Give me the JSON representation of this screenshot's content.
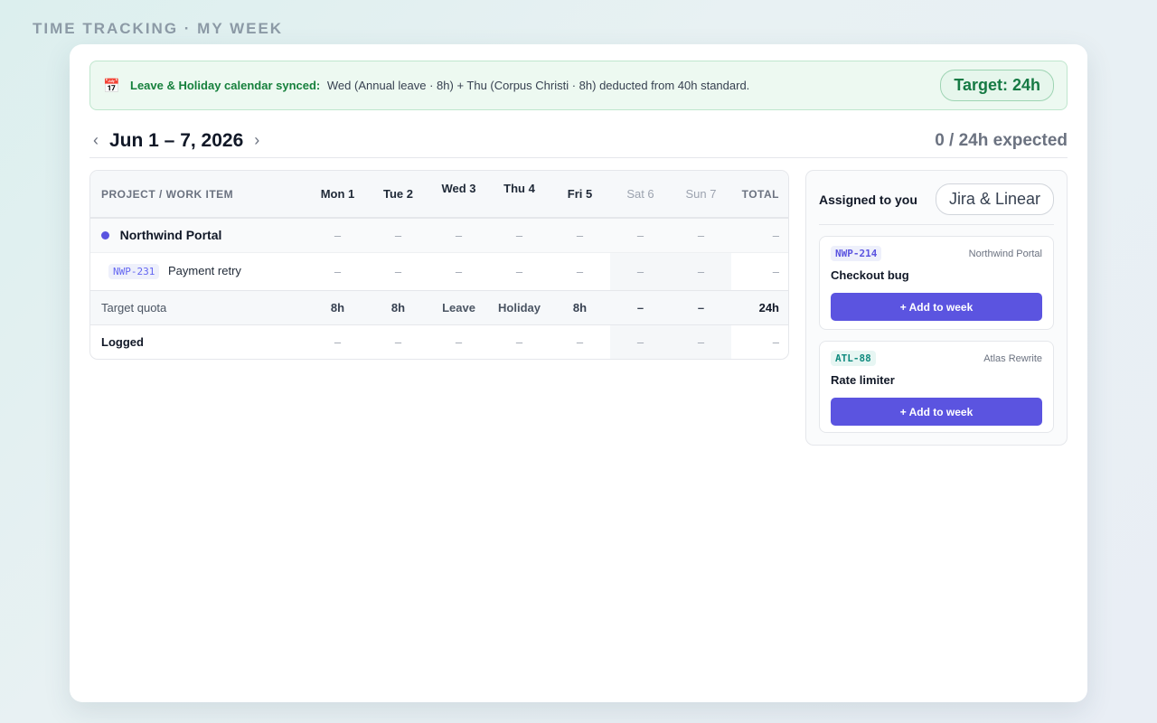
{
  "page_title": "TIME TRACKING · MY WEEK",
  "banner": {
    "icon": "calendar-icon",
    "label": "Leave & Holiday calendar synced:",
    "text": "Wed (Annual leave · 8h) + Thu (Corpus Christi · 8h) deducted from 40h standard.",
    "target": "Target: 24h"
  },
  "week_nav": {
    "prev": "‹",
    "range": "Jun 1 – 7, 2026",
    "next": "›",
    "expected": "0 / 24h expected"
  },
  "grid": {
    "project_header": "PROJECT / WORK ITEM",
    "days": [
      "Mon 1",
      "Tue 2",
      "Wed 3",
      "Thu 4",
      "Fri 5",
      "Sat 6",
      "Sun 7"
    ],
    "total_header": "TOTAL",
    "project": {
      "name": "Northwind Portal",
      "cells": [
        "–",
        "–",
        "–",
        "–",
        "–",
        "–",
        "–"
      ],
      "total": "–"
    },
    "item": {
      "key": "NWP-231",
      "title": "Payment retry",
      "cells": [
        "–",
        "–",
        "–",
        "–",
        "–",
        "–",
        "–"
      ],
      "total": "–"
    },
    "quota": {
      "label": "Target quota",
      "cells": [
        "8h",
        "8h",
        "Leave",
        "Holiday",
        "8h",
        "–",
        "–"
      ],
      "total": "24h"
    },
    "logged": {
      "label": "Logged",
      "cells": [
        "–",
        "–",
        "–",
        "–",
        "–",
        "–",
        "–"
      ],
      "total": "–"
    }
  },
  "side_panel": {
    "title": "Assigned to you",
    "source": "Jira & Linear",
    "tasks": [
      {
        "key": "NWP-214",
        "project": "Northwind Portal",
        "title": "Checkout bug",
        "button": "+ Add to week"
      },
      {
        "key": "ATL-88",
        "project": "Atlas Rewrite",
        "title": "Rate limiter",
        "button": "+ Add to week"
      }
    ]
  },
  "colors": {
    "accent": "#5b54e0",
    "success": "#16803c",
    "teal": "#0f8a7e"
  }
}
